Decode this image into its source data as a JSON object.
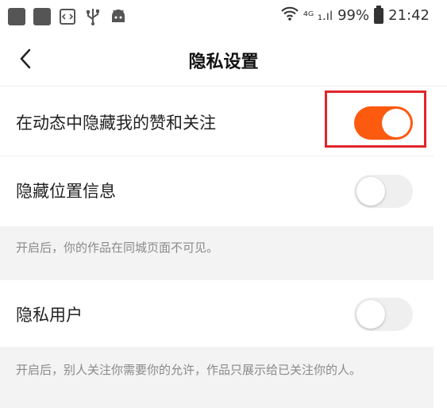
{
  "status_bar": {
    "signal": "⁴ᴳ ₁.ıl",
    "battery": "99%",
    "time": "21:42"
  },
  "nav": {
    "back_icon": "chevron-left-icon",
    "title": "隐私设置"
  },
  "settings": [
    {
      "label": "在动态中隐藏我的赞和关注",
      "toggle_on": true
    },
    {
      "label": "隐藏位置信息",
      "toggle_on": false,
      "hint": "开启后，你的作品在同城页面不可见。"
    },
    {
      "label": "隐私用户",
      "toggle_on": false,
      "hint": "开启后，别人关注你需要你的允许，作品只展示给已关注你的人。"
    }
  ],
  "colors": {
    "accent": "#fb5a0f",
    "highlight_box": "#e1252a",
    "hint_bg": "#f3f3f3"
  }
}
